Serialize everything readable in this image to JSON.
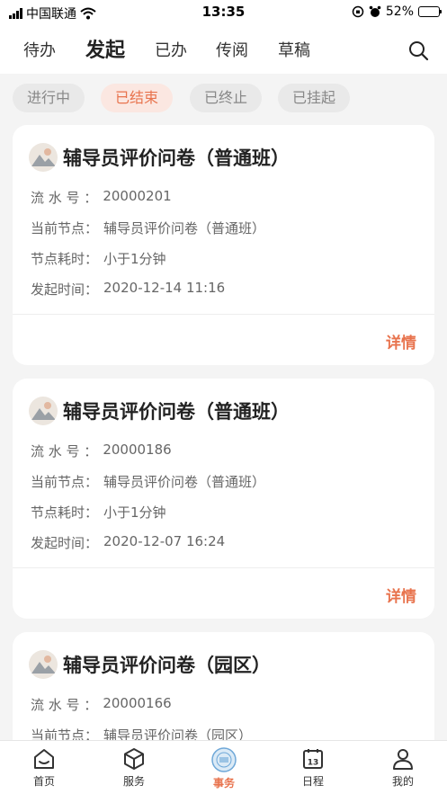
{
  "status": {
    "carrier": "中国联通",
    "time": "13:35",
    "battery": "52%",
    "battery_level": 0.52
  },
  "tabs": [
    "待办",
    "发起",
    "已办",
    "传阅",
    "草稿"
  ],
  "active_tab": "发起",
  "filters": [
    "进行中",
    "已结束",
    "已终止",
    "已挂起"
  ],
  "active_filter": "已结束",
  "labels": {
    "serial": "流 水 号 ：",
    "node": "当前节点：",
    "duration": "节点耗时：",
    "start_time": "发起时间：",
    "detail": "详情"
  },
  "cards": [
    {
      "title": "辅导员评价问卷（普通班）",
      "serial": "20000201",
      "node": "辅导员评价问卷（普通班）",
      "duration": "小于1分钟",
      "start_time": "2020-12-14 11:16"
    },
    {
      "title": "辅导员评价问卷（普通班）",
      "serial": "20000186",
      "node": "辅导员评价问卷（普通班）",
      "duration": "小于1分钟",
      "start_time": "2020-12-07 16:24"
    },
    {
      "title": "辅导员评价问卷（园区）",
      "serial": "20000166",
      "node": "辅导员评价问卷（园区）"
    }
  ],
  "bottom_nav": [
    {
      "label": "首页",
      "icon": "home-icon"
    },
    {
      "label": "服务",
      "icon": "cube-icon"
    },
    {
      "label": "事务",
      "icon": "affairs-logo-icon"
    },
    {
      "label": "日程",
      "icon": "calendar-icon",
      "badge": "13"
    },
    {
      "label": "我的",
      "icon": "person-icon"
    }
  ],
  "active_bottom": "事务",
  "colors": {
    "accent": "#e8734d",
    "chip_active_bg": "#fbe7e1",
    "background": "#f4f4f4"
  }
}
